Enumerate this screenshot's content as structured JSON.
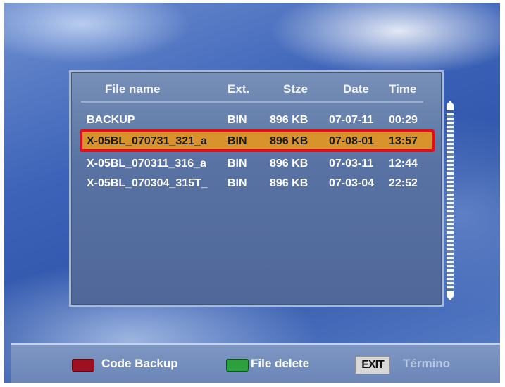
{
  "columns": {
    "file_name": "File name",
    "ext": "Ext.",
    "size": "Stze",
    "date": "Date",
    "time": "Time"
  },
  "rows": [
    {
      "name": "BACKUP",
      "ext": "BIN",
      "size": "896 KB",
      "date": "07-07-11",
      "time": "00:29",
      "selected": false
    },
    {
      "name": "X-05BL_070731_321_a",
      "ext": "BIN",
      "size": "896 KB",
      "date": "07-08-01",
      "time": "13:57",
      "selected": true
    },
    {
      "name": "X-05BL_070311_316_a",
      "ext": "BIN",
      "size": "896 KB",
      "date": "07-03-11",
      "time": "12:44",
      "selected": false
    },
    {
      "name": "X-05BL_070304_315T_",
      "ext": "BIN",
      "size": "896 KB",
      "date": "07-03-04",
      "time": "22:52",
      "selected": false
    }
  ],
  "footer": {
    "red_label": "Code Backup",
    "green_label": "File delete",
    "exit_key": "EXIT",
    "exit_label": "Término"
  },
  "colors": {
    "selection": "#d9932d",
    "selection_outline": "#e0101a",
    "red_key": "#9c1020",
    "green_key": "#2ca03c"
  },
  "icons": [
    "scroll-up-arrow-icon",
    "scroll-down-arrow-icon",
    "red-key-icon",
    "green-key-icon"
  ]
}
